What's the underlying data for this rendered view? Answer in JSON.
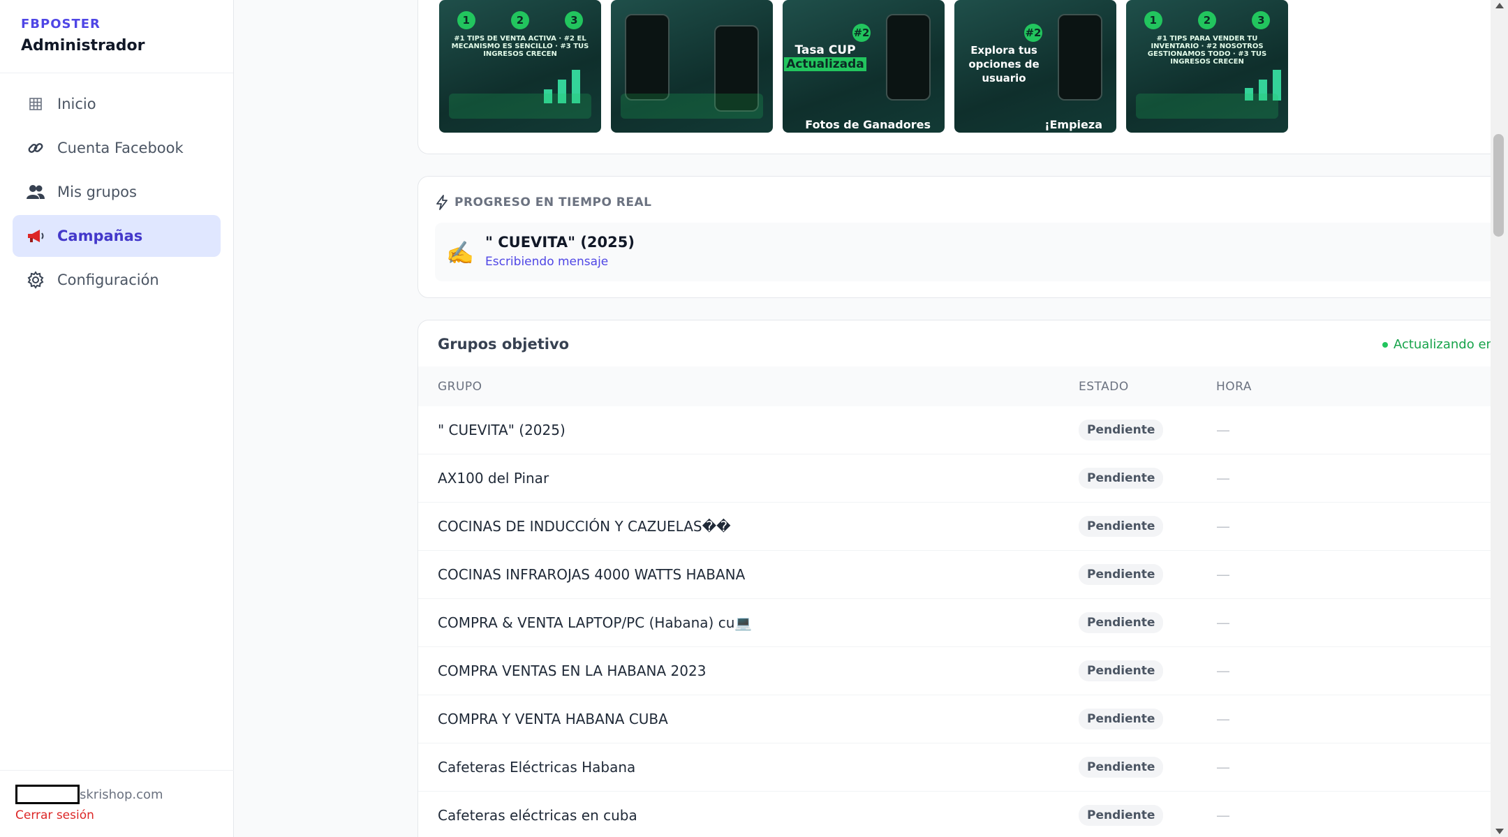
{
  "brand": {
    "name": "FBPOSTER",
    "role": "Administrador"
  },
  "nav": [
    {
      "label": "Inicio",
      "icon": "grid-icon",
      "active": false
    },
    {
      "label": "Cuenta Facebook",
      "icon": "link-icon",
      "active": false
    },
    {
      "label": "Mis grupos",
      "icon": "users-icon",
      "active": false
    },
    {
      "label": "Campañas",
      "icon": "megaphone-icon",
      "active": true
    },
    {
      "label": "Configuración",
      "icon": "gear-icon",
      "active": false
    }
  ],
  "footer": {
    "email_suffix": "skrishop.com",
    "logout": "Cerrar sesión"
  },
  "gallery": {
    "thumbs": [
      {
        "nums": [
          "1",
          "2",
          "3"
        ],
        "caption": "#1 TIPS DE VENTA ACTIVA · #2 EL MECANISMO ES SENCILLO · #3 TUS INGRESOS CRECEN"
      },
      {
        "nums": [],
        "caption": ""
      },
      {
        "nums": [
          "#2"
        ],
        "line1": "Tasa CUP",
        "line2": "Actualizada",
        "foot": "Fotos de Ganadores"
      },
      {
        "nums": [
          "#2"
        ],
        "line1": "Explora tus opciones de",
        "line2": "usuario",
        "foot": "¡Empieza"
      },
      {
        "nums": [
          "1",
          "2",
          "3"
        ],
        "caption": "#1 TIPS PARA VENDER TU INVENTARIO · #2 NOSOTROS GESTIONAMOS TODO · #3 TUS INGRESOS CRECEN"
      }
    ]
  },
  "progress": {
    "title": "PROGRESO EN TIEMPO REAL",
    "group": "\" CUEVITA\" (2025)",
    "status": "Escribiendo mensaje",
    "emoji": "✍️"
  },
  "groups": {
    "title": "Grupos objetivo",
    "live": "Actualizando en vivo",
    "headers": {
      "group": "GRUPO",
      "state": "ESTADO",
      "hour": "HORA"
    },
    "rows": [
      {
        "group": "\" CUEVITA\" (2025)",
        "state": "Pendiente",
        "hour": "—"
      },
      {
        "group": "AX100 del Pinar",
        "state": "Pendiente",
        "hour": "—"
      },
      {
        "group": "COCINAS DE INDUCCIÓN Y CAZUELAS��",
        "state": "Pendiente",
        "hour": "—"
      },
      {
        "group": "COCINAS INFRAROJAS 4000 WATTS HABANA",
        "state": "Pendiente",
        "hour": "—"
      },
      {
        "group": "COMPRA & VENTA LAPTOP/PC (Habana) cu💻",
        "state": "Pendiente",
        "hour": "—"
      },
      {
        "group": "COMPRA VENTAS EN LA HABANA 2023",
        "state": "Pendiente",
        "hour": "—"
      },
      {
        "group": "COMPRA Y VENTA HABANA CUBA",
        "state": "Pendiente",
        "hour": "—"
      },
      {
        "group": "Cafeteras Eléctricas Habana",
        "state": "Pendiente",
        "hour": "—"
      },
      {
        "group": "Cafeteras eléctricas en cuba",
        "state": "Pendiente",
        "hour": "—"
      }
    ]
  },
  "colors": {
    "accent": "#4f46e5",
    "active_bg": "#e0e7ff",
    "live": "#16a34a",
    "logout": "#dc2626"
  }
}
